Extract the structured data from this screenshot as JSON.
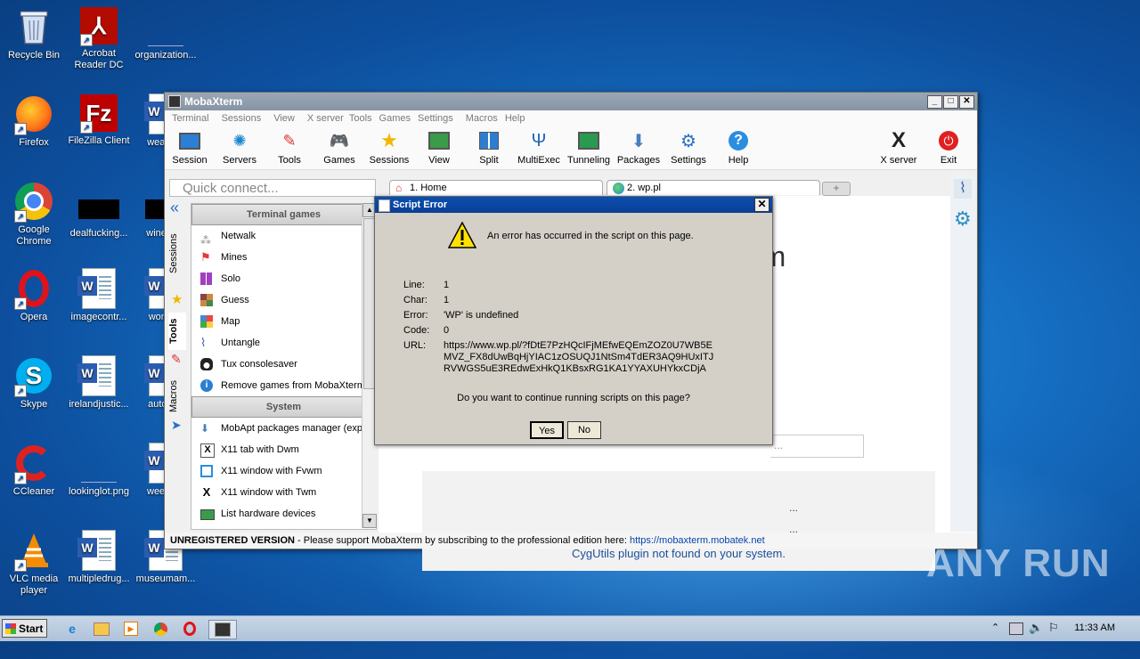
{
  "desktop": {
    "icons": [
      {
        "label": "Recycle Bin"
      },
      {
        "label": "Acrobat Reader DC"
      },
      {
        "label": "organization..."
      },
      {
        "label": "Firefox"
      },
      {
        "label": "FileZilla Client"
      },
      {
        "label": "weann..."
      },
      {
        "label": "Google Chrome"
      },
      {
        "label": "dealfucking..."
      },
      {
        "label": "winexe..."
      },
      {
        "label": "Opera"
      },
      {
        "label": "imagecontr..."
      },
      {
        "label": "woma..."
      },
      {
        "label": "Skype"
      },
      {
        "label": "irelandjustic..."
      },
      {
        "label": "autom..."
      },
      {
        "label": "CCleaner"
      },
      {
        "label": "lookinglot.png"
      },
      {
        "label": "weekly..."
      },
      {
        "label": "VLC media player"
      },
      {
        "label": "multipledrug..."
      },
      {
        "label": "museumam..."
      }
    ]
  },
  "window": {
    "title": "MobaXterm",
    "menu": [
      "Terminal",
      "Sessions",
      "View",
      "X server",
      "Tools",
      "Games",
      "Settings",
      "Macros",
      "Help"
    ],
    "toolbar": [
      "Session",
      "Servers",
      "Tools",
      "Games",
      "Sessions",
      "View",
      "Split",
      "MultiExec",
      "Tunneling",
      "Packages",
      "Settings",
      "Help"
    ],
    "toolbar_right": [
      "X server",
      "Exit"
    ],
    "quick_connect_placeholder": "Quick connect...",
    "tabs": [
      "1. Home",
      "2. wp.pl"
    ],
    "side_tabs": [
      "Sessions",
      "Tools",
      "Macros"
    ],
    "panel": {
      "section1": "Terminal games",
      "games": [
        "Netwalk",
        "Mines",
        "Solo",
        "Guess",
        "Map",
        "Untangle",
        "Tux consolesaver",
        "Remove games from MobaXterm"
      ],
      "section2": "System",
      "system": [
        "MobApt packages manager (expe",
        "X11 tab with Dwm",
        "X11 window with Fvwm",
        "X11 window with Twm",
        "List hardware devices"
      ]
    },
    "content": {
      "title_fragment": "rm",
      "search_fragment": "...",
      "list_fragments": [
        "...",
        "..."
      ],
      "cygutils_msg": "CygUtils plugin not found on your system."
    },
    "status": {
      "unregistered": "UNREGISTERED VERSION",
      "message": " -  Please support MobaXterm by subscribing to the professional edition here:  ",
      "link": "https://mobaxterm.mobatek.net"
    }
  },
  "dialog": {
    "title": "Script Error",
    "message": "An error has occurred in the script on this page.",
    "fields": [
      {
        "label": "Line:",
        "value": "1"
      },
      {
        "label": "Char:",
        "value": "1"
      },
      {
        "label": "Error:",
        "value": "'WP' is undefined"
      },
      {
        "label": "Code:",
        "value": "0"
      }
    ],
    "url_label": "URL:",
    "url": "https://www.wp.pl/?fDtE7PzHQcIFjMEfwEQEmZOZ0U7WB5EMVZ_FX8dUwBqHjYIAC1zOSUQJ1NtSm4TdER3AQ9HUxITJRVWGS5uE3REdwExHkQ1KBsxRG1KA1YYAXUHYkxCDjA",
    "question": "Do you want to continue running scripts on this page?",
    "yes": "Yes",
    "no": "No"
  },
  "taskbar": {
    "start": "Start",
    "time": "11:33 AM"
  },
  "watermark": "ANY RUN"
}
